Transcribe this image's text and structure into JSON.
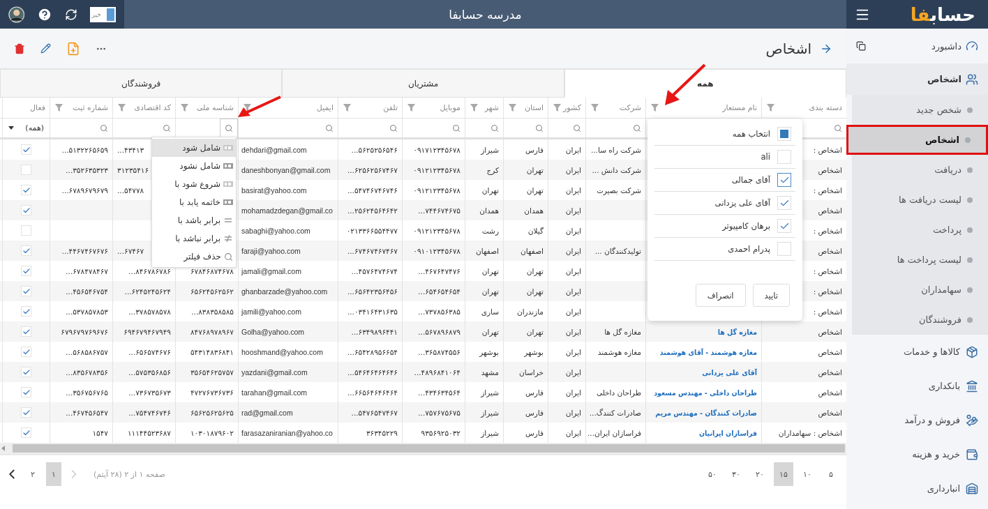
{
  "header": {
    "title": "مدرسه حسابفا",
    "logo": {
      "text": "حساب",
      "accent": "فا"
    },
    "toggle": {
      "label": "خیر",
      "on": false
    }
  },
  "sidebar": {
    "items": [
      {
        "label": "داشبورد"
      },
      {
        "label": "اشخاص",
        "expanded": true,
        "children": [
          {
            "label": "شخص جدید",
            "selected": false,
            "outlined": false
          },
          {
            "label": "اشخاص",
            "selected": true,
            "outlined": true
          },
          {
            "label": "دریافت",
            "selected": false,
            "outlined": false
          },
          {
            "label": "لیست دریافت ها",
            "selected": false,
            "outlined": false
          },
          {
            "label": "پرداخت",
            "selected": false,
            "outlined": false
          },
          {
            "label": "لیست پرداخت ها",
            "selected": false,
            "outlined": false
          },
          {
            "label": "سهامداران",
            "selected": false,
            "outlined": false
          },
          {
            "label": "فروشندگان",
            "selected": false,
            "outlined": false
          }
        ]
      },
      {
        "label": "کالاها و خدمات"
      },
      {
        "label": "بانکداری"
      },
      {
        "label": "فروش و درآمد"
      },
      {
        "label": "خرید و هزینه"
      },
      {
        "label": "انبارداری"
      }
    ]
  },
  "page": {
    "title": "اشخاص"
  },
  "tabs": [
    {
      "label": "همه",
      "selected": true
    },
    {
      "label": "مشتریان",
      "selected": false
    },
    {
      "label": "فروشندگان",
      "selected": false
    }
  ],
  "table": {
    "columns": [
      {
        "label": "دسته بندی",
        "funnel": true,
        "filter": {
          "kind": "search",
          "open": false
        }
      },
      {
        "label": "نام مستعار",
        "funnel": true
      },
      {
        "label": "شرکت",
        "funnel": true,
        "filter": {
          "kind": "search",
          "open": false
        }
      },
      {
        "label": "کشور",
        "funnel": true,
        "filter": {
          "kind": "search",
          "open": false
        }
      },
      {
        "label": "استان",
        "funnel": true,
        "filter": {
          "kind": "search",
          "open": false
        }
      },
      {
        "label": "شهر",
        "funnel": true,
        "filter": {
          "kind": "search",
          "open": false
        }
      },
      {
        "label": "موبایل",
        "funnel": true,
        "filter": {
          "kind": "search",
          "open": false
        }
      },
      {
        "label": "تلفن",
        "funnel": true,
        "filter": {
          "kind": "search",
          "open": false
        }
      },
      {
        "label": "ایمیل",
        "funnel": true,
        "filter": {
          "kind": "search",
          "open": false
        }
      },
      {
        "label": "شناسه ملی",
        "funnel": true,
        "filter": {
          "kind": "search",
          "open": true
        }
      },
      {
        "label": "کد اقتصادی",
        "funnel": true,
        "filter": {
          "kind": "search",
          "open": false
        }
      },
      {
        "label": "شماره ثبت",
        "funnel": true,
        "filter": {
          "kind": "search",
          "open": false
        }
      },
      {
        "label": "فعال",
        "funnel": false,
        "filter": {
          "kind": "select",
          "value": "(همه)"
        }
      }
    ],
    "rows": [
      {
        "category": "اشخاص :",
        "company": "شرکت راه سا...",
        "country": "ایران",
        "province": "فارس",
        "city": "شیراز",
        "mobile": "۰۹۱۷۱۲۳۴۵۶۷۸",
        "phone": "۵۶۲۵۲۵۶۵۴۶...",
        "email": "dehdari@gmail.com",
        "economic_code": "۴۳۴۱۳...",
        "economic_code_cut": true,
        "registration_no": "۵۱۳۲۲۶۵۶۵۹...",
        "active": true
      },
      {
        "category": "اشخاص",
        "company": "شرکت دانش ...",
        "country": "ایران",
        "province": "تهران",
        "city": "کرج",
        "mobile": "۰۹۱۲۱۲۳۴۵۶۷۸",
        "phone": "۶۲۵۶۲۵۶۷۴۶۷...",
        "email": "daneshbonyan@gmail.com",
        "economic_code": "۳۱۲۳۵۴۱۶",
        "economic_code_cut": true,
        "registration_no": "۳۵۲۶۳۵۳۲۳...",
        "active": false
      },
      {
        "category": "اشخاص :",
        "company": "شرکت بصیرت",
        "country": "ایران",
        "province": "تهران",
        "city": "تهران",
        "mobile": "۰۹۱۲۱۲۳۴۵۶۷۸",
        "phone": "۵۴۷۴۶۷۴۶۷۴۶...",
        "email": "basirat@yahoo.com",
        "economic_code": "۵۴۷۷۸...",
        "economic_code_cut": true,
        "registration_no": "۶۷۸۹۶۷۹۶۷۹...",
        "active": true
      },
      {
        "category": "اشخاص",
        "country": "ایران",
        "province": "همدان",
        "city": "همدان",
        "mobile": "۷۴۴۶۷۴۶۷۵...",
        "phone": "۲۵۶۲۴۵۶۴۶۴۲...",
        "email": "mohamadzdegan@gmail.co",
        "active": true
      },
      {
        "category": "اشخاص :",
        "country": "ایران",
        "province": "گیلان",
        "city": "رشت",
        "mobile": "۰۹۱۲۱۲۳۴۵۶۷۸",
        "phone": "۰۲۱۳۳۶۶۵۵۴۴۷۷",
        "email": "sabaghi@yahoo.com",
        "active": false
      },
      {
        "category": "اشخاص",
        "company": "تولیدکنندگان ...",
        "country": "ایران",
        "province": "اصفهان",
        "city": "اصفهان",
        "mobile": "۰۹۱۰۱۲۳۴۵۶۷۸",
        "phone": "۶۷۴۶۷۴۶۷۴۶۷...",
        "email": "faraji@yahoo.com",
        "economic_code": "۶۷۴۶۷...",
        "economic_code_cut": true,
        "registration_no": "۴۴۶۷۴۶۷۶۷۶...",
        "active": true
      },
      {
        "category": "اشخاص :",
        "country": "ایران",
        "province": "تهران",
        "city": "تهران",
        "mobile": "۴۶۷۶۴۷۴۷۶...",
        "phone": "۴۵۷۶۴۷۴۶۷۴...",
        "email": "jamali@gmail.com",
        "national_id": "۶۷۸۴۶۸۷۴۶۷۸",
        "economic_code": "۸۴۶۷۸۶۷۸۶...",
        "registration_no": "۶۷۸۴۷۸۴۶۷...",
        "active": true
      },
      {
        "category": "اشخاص :",
        "country": "ایران",
        "province": "تهران",
        "city": "تهران",
        "mobile": "۶۵۴۶۵۴۶۵۴...",
        "phone": "۶۵۶۴۲۳۵۶۴۵۶...",
        "email": "ghanbarzade@yahoo.com",
        "national_id": "۶۵۶۲۴۵۶۲۵۶۲",
        "economic_code": "۶۲۴۵۲۴۵۶۲۴...",
        "registration_no": "۴۵۶۵۴۶۷۵۴...",
        "active": true
      },
      {
        "category": "اشخاص :",
        "country": "ایران",
        "province": "مازندران",
        "city": "ساری",
        "mobile": "۷۳۷۸۵۶۳۸۵...",
        "phone": "۰۳۴۱۶۴۳۱۶۳۵...",
        "email": "jamili@yahoo.com",
        "national_id": "۸۳۸۳۵۸۵۸۵...",
        "economic_code": "۳۷۸۵۷۸۵۷۸...",
        "registration_no": "۵۳۷۸۵۷۸۵۳...",
        "active": true
      },
      {
        "category": "اشخاص",
        "name": "مغازه گل ها",
        "company": "مغازه گل ها",
        "country": "ایران",
        "province": "تهران",
        "city": "تهران",
        "mobile": "۵۶۷۸۹۶۸۷۹...",
        "phone": "۶۳۴۹۸۹۶۴۴۱...",
        "email": "Golha@yahoo.com",
        "national_id": "۸۴۷۶۸۹۷۸۹۶۷",
        "economic_code": "۶۹۴۶۷۹۴۶۷۹۴۹",
        "registration_no": "۶۷۹۶۷۹۷۶۹۶۷۶",
        "active": true
      },
      {
        "category": "اشخاص",
        "name": "مغازه هوشمند - آقای هوشمند",
        "company": "مغازه هوشمند",
        "country": "ایران",
        "province": "بوشهر",
        "city": "بوشهر",
        "mobile": "۳۶۵۸۷۴۵۵۶...",
        "phone": "۶۵۴۲۸۹۵۶۶۵۴...",
        "email": "hooshmand@yahoo.com",
        "national_id": "۵۴۳۱۴۸۳۶۸۴۱",
        "economic_code": "۶۵۶۵۷۴۶۷۶...",
        "registration_no": "۵۶۸۵۸۶۷۵۷...",
        "active": true
      },
      {
        "category": "اشخاص",
        "name": "آقای علی یزدانی",
        "country": "ایران",
        "province": "خراسان",
        "city": "مشهد",
        "mobile": "۴۸۹۶۸۴۱۰۶۴...",
        "phone": "۵۴۶۴۶۴۶۴۶۴۶...",
        "email": "yazdani@gmail.com",
        "national_id": "۳۵۶۵۴۶۲۵۷۵۷",
        "economic_code": "۵۷۵۳۵۶۸۵۶...",
        "registration_no": "۸۳۵۶۷۸۳۵۶...",
        "active": true
      },
      {
        "category": "اشخاص",
        "name": "طراحان داخلی - مهندس مسعود",
        "company": "طراحان داخلی",
        "country": "ایران",
        "province": "فارس",
        "city": "شیراز",
        "mobile": "۴۳۴۶۳۴۵۶۴...",
        "phone": "۶۶۵۶۴۶۴۶۴۶۴...",
        "email": "tarahan@gmail.com",
        "national_id": "۴۷۲۷۶۷۳۶۷۳۶",
        "economic_code": "۷۳۶۷۳۵۶۷۳...",
        "registration_no": "۳۵۶۷۵۶۷۶۵...",
        "active": true
      },
      {
        "category": "اشخاص",
        "name": "صادرات کنندگان - مهندس مریم",
        "company": "صادرات کنندگ...",
        "country": "ایران",
        "province": "فارس",
        "city": "شیراز",
        "mobile": "۷۵۷۶۷۵۶۷۵...",
        "phone": "۵۴۷۶۵۴۷۴۶۷...",
        "email": "rad@gmail.com",
        "national_id": "۶۵۶۲۵۶۲۵۶۲۵",
        "economic_code": "۷۵۴۷۴۶۷۴۶...",
        "registration_no": "۴۶۷۴۵۶۵۴۷...",
        "active": true
      },
      {
        "category": "اشخاص : سهامداران",
        "name": "فراسازان ایرانیان",
        "company": "فراسازان ایران...",
        "country": "ایران",
        "province": "فارس",
        "city": "شیراز",
        "mobile": "۹۳۵۶۹۲۵۰۳۲",
        "phone": "۳۶۳۴۵۲۲۹",
        "email": "farasazaniranian@yahoo.co",
        "national_id": "۱۰۳۰۱۸۷۹۶۰۲",
        "economic_code": "۱۱۱۴۴۵۲۳۶۸۷",
        "registration_no": "۱۵۴۷",
        "active": true
      }
    ]
  },
  "filter_popup": {
    "select_all": {
      "label": "انتخاب همه",
      "indeterminate": true
    },
    "options": [
      {
        "label": "ali",
        "checked": false
      },
      {
        "label": "آقای جمالی",
        "checked": true
      },
      {
        "label": "آقای علی یزدانی",
        "checked": true
      },
      {
        "label": "برهان کامپیوتر",
        "checked": true
      },
      {
        "label": "پدرام احمدی",
        "checked": false
      }
    ],
    "buttons": [
      "تایید",
      "انصراف"
    ]
  },
  "filter_menu": {
    "items": [
      {
        "label": "شامل شود",
        "selected": true
      },
      {
        "label": "شامل نشود",
        "selected": false
      },
      {
        "label": "شروع شود با",
        "selected": false
      },
      {
        "label": "خاتمه یابد با",
        "selected": false
      },
      {
        "label": "برابر باشد با",
        "selected": false
      },
      {
        "label": "برابر نباشد با",
        "selected": false
      },
      {
        "label": "حذف فیلتر",
        "selected": false
      }
    ]
  },
  "pagination": {
    "page_sizes": [
      {
        "label": "۵",
        "selected": false
      },
      {
        "label": "۱۰",
        "selected": false
      },
      {
        "label": "۱۵",
        "selected": true
      },
      {
        "label": "۲۰",
        "selected": false
      },
      {
        "label": "۳۰",
        "selected": false
      },
      {
        "label": "۵۰",
        "selected": false
      }
    ],
    "info": "صفحه ۱ از ۲ (۲۸ آیتم)",
    "pages": [
      {
        "label": "۱",
        "selected": true
      },
      {
        "label": "۲",
        "selected": false
      }
    ]
  }
}
